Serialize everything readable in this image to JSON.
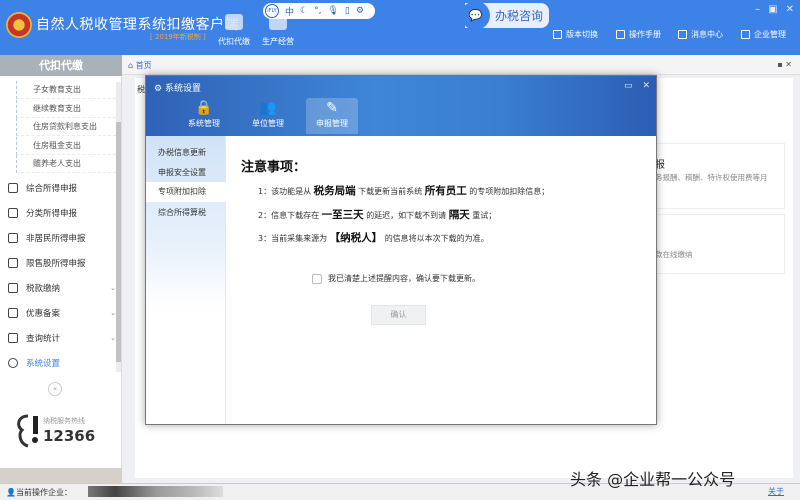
{
  "app": {
    "title": "自然人税收管理系统扣缴客户端",
    "subtitle": "[ 2019年新税制 ]",
    "top_modules": [
      "代扣代缴",
      "生产经营"
    ],
    "toolbar": {
      "brand": "iFLY",
      "lang": "中"
    },
    "consult_label": "办税咨询",
    "nav": [
      "版本切换",
      "操作手册",
      "消息中心",
      "企业管理"
    ],
    "window_controls": [
      "–",
      "▣",
      "✕"
    ],
    "accent": "#3d82e6"
  },
  "sidebar": {
    "header": "代扣代缴",
    "subitems": [
      "子女教育支出",
      "继续教育支出",
      "住房贷款利息支出",
      "住房租金支出",
      "赡养老人支出"
    ],
    "items": [
      {
        "label": "综合所得申报",
        "icon": "layers-icon"
      },
      {
        "label": "分类所得申报",
        "icon": "pie-icon"
      },
      {
        "label": "非居民所得申报",
        "icon": "person-icon"
      },
      {
        "label": "限售股所得申报",
        "icon": "bar-chart-icon"
      },
      {
        "label": "税款缴纳",
        "icon": "folder-icon",
        "chevron": true
      },
      {
        "label": "优惠备案",
        "icon": "doc-icon",
        "chevron": true
      },
      {
        "label": "查询统计",
        "icon": "search-list-icon",
        "chevron": true
      },
      {
        "label": "系统设置",
        "icon": "gear-icon",
        "active": true
      }
    ],
    "collapse": "«",
    "hotline_label": "纳税服务热线",
    "hotline_number": "12366"
  },
  "tabs": {
    "home": "首页"
  },
  "background": {
    "text1": "税",
    "card1_title": "报",
    "card1_desc": "务报酬、稿酬、特许权使用费等月",
    "card2_desc": "款在线缴纳"
  },
  "status": {
    "label": "当前操作企业：",
    "close": "关于"
  },
  "watermark": "头条 @企业帮一公众号",
  "dialog": {
    "title": "系统设置",
    "tabs": [
      "系统管理",
      "单位管理",
      "申报管理"
    ],
    "active_tab": "申报管理",
    "nav": [
      "办税信息更新",
      "申报安全设置",
      "专项附加扣除",
      "综合所得算税"
    ],
    "active_nav": "专项附加扣除",
    "notice_title": "注意事项：",
    "lines": [
      {
        "p1": "1：该功能是从",
        "b1": "税务局端",
        "p2": "下载更新当前系统",
        "b2": "所有员工",
        "p3": "的专项附加扣除信息；"
      },
      {
        "p1": "2：信息下载存在",
        "b1": "一至三天",
        "p2": "的延迟，如下载不到请",
        "b2": "隔天",
        "p3": "重试；"
      },
      {
        "p1": "3：当前采集来源为",
        "b1": "【纳税人】",
        "p2": "的信息将以本次下载的为准。",
        "b2": "",
        "p3": ""
      }
    ],
    "checkbox_label": "我已清楚上述提醒内容，确认要下载更新。",
    "checked": false,
    "confirm": "确认"
  }
}
